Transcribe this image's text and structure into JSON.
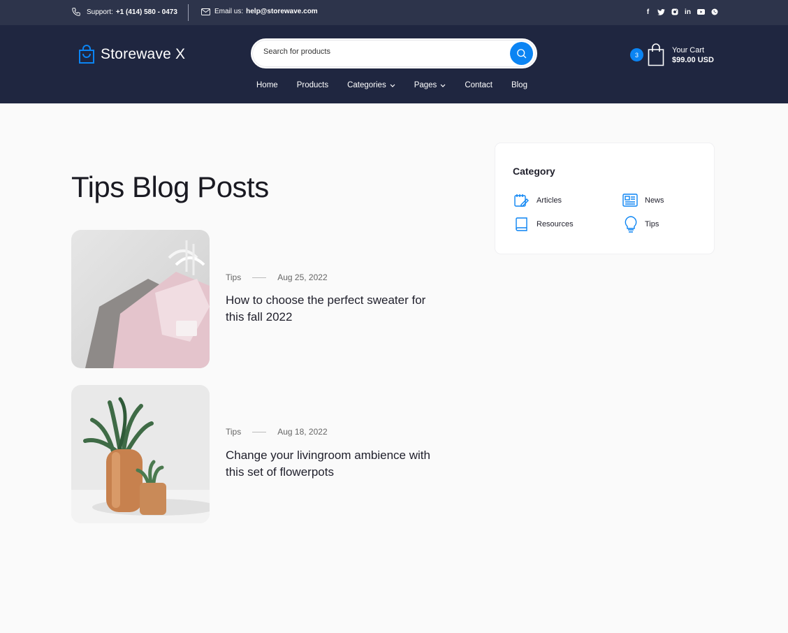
{
  "topbar": {
    "support_label": "Support:",
    "support_phone": "+1 (414) 580 - 0473",
    "email_label": "Email us:",
    "email_address": "help@storewave.com",
    "social": [
      "facebook-icon",
      "twitter-icon",
      "instagram-icon",
      "linkedin-icon",
      "youtube-icon",
      "whatsapp-icon"
    ]
  },
  "header": {
    "logo_text": "Storewave X",
    "search_placeholder": "Search for products",
    "cart_count": "3",
    "cart_label": "Your Cart",
    "cart_total": "$99.00 USD"
  },
  "nav": {
    "items": [
      {
        "label": "Home",
        "dropdown": false
      },
      {
        "label": "Products",
        "dropdown": false
      },
      {
        "label": "Categories",
        "dropdown": true
      },
      {
        "label": "Pages",
        "dropdown": true
      },
      {
        "label": "Contact",
        "dropdown": false
      },
      {
        "label": "Blog",
        "dropdown": false
      }
    ]
  },
  "main": {
    "title": "Tips Blog Posts",
    "posts": [
      {
        "category": "Tips",
        "date": "Aug 25, 2022",
        "title": "How to choose the perfect sweater for this fall 2022"
      },
      {
        "category": "Tips",
        "date": "Aug 18, 2022",
        "title": "Change your livingroom ambience with this set of flowerpots"
      }
    ]
  },
  "sidebar": {
    "heading": "Category",
    "categories": [
      {
        "label": "Articles",
        "icon": "notepad-pencil-icon"
      },
      {
        "label": "News",
        "icon": "newspaper-icon"
      },
      {
        "label": "Resources",
        "icon": "book-icon"
      },
      {
        "label": "Tips",
        "icon": "lightbulb-icon"
      }
    ]
  },
  "colors": {
    "topbar_bg": "#2d344b",
    "header_bg": "#1f2640",
    "accent": "#0b84f3",
    "page_bg": "#fafafa"
  }
}
